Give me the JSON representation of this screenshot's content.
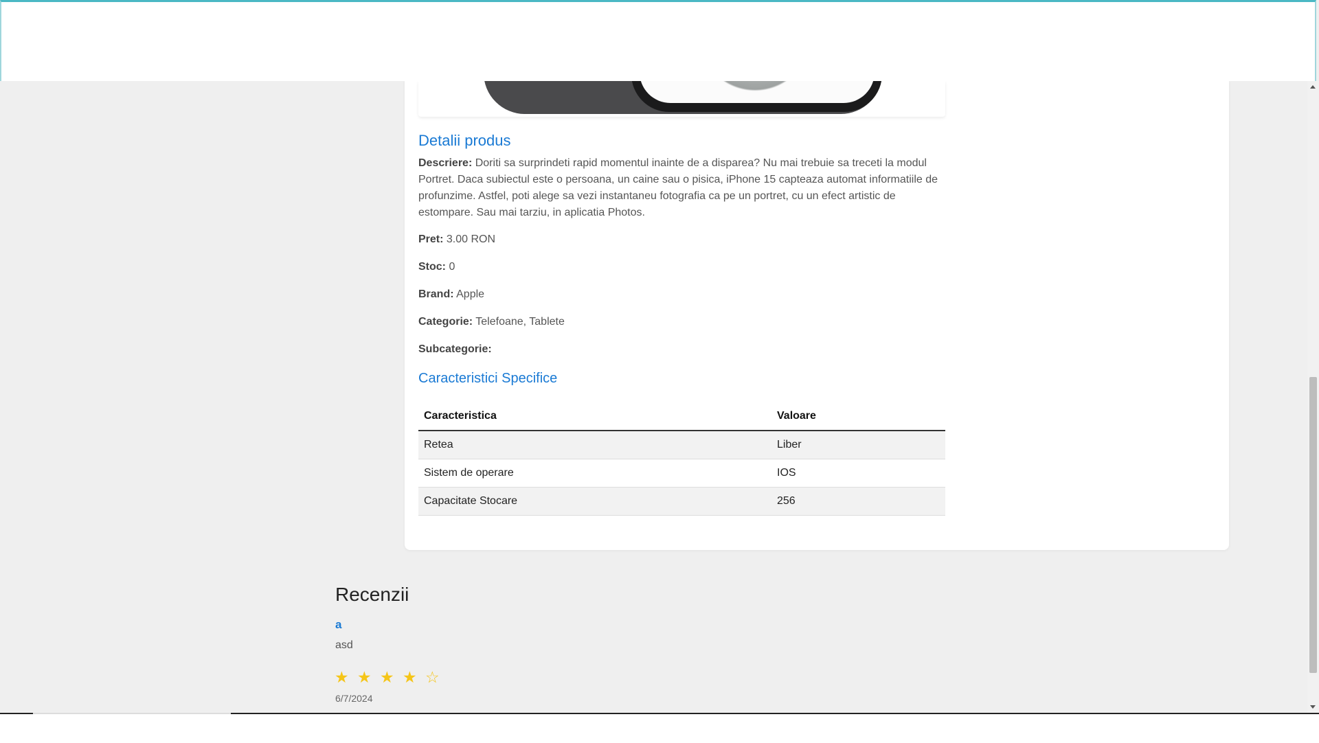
{
  "product": {
    "details_title": "Detalii produs",
    "description_label": "Descriere:",
    "description": " Doriti sa surprindeti rapid momentul inainte de a disparea? Nu mai trebuie sa treceti la modul Portret. Daca subiectul este o persoana, un caine sau o pisica, iPhone 15 capteaza automat informatiile de profunzime. Astfel, poti alege sa vezi instantaneu fotografia ca pe un portret, cu un efect artistic de estompare. Sau mai tarziu, in aplicatia Photos.",
    "price_label": "Pret:",
    "price": " 3.00 RON",
    "stock_label": "Stoc:",
    "stock": " 0",
    "brand_label": "Brand:",
    "brand": " Apple",
    "category_label": "Categorie:",
    "category": " Telefoane, Tablete",
    "subcategory_label": "Subcategorie:",
    "subcategory": ""
  },
  "specs": {
    "title": "Caracteristici Specifice",
    "header_characteristic": "Caracteristica",
    "header_value": "Valoare",
    "rows": [
      {
        "name": "Retea",
        "value": "Liber"
      },
      {
        "name": "Sistem de operare",
        "value": "IOS"
      },
      {
        "name": "Capacitate Stocare",
        "value": "256"
      }
    ]
  },
  "reviews": {
    "title": "Recenzii",
    "items": [
      {
        "author": "a",
        "text": "asd",
        "stars": "★ ★ ★ ★ ☆",
        "rating": 4,
        "max_rating": 5,
        "date": "6/7/2024"
      }
    ]
  },
  "colors": {
    "accent_blue": "#1a7ad4",
    "star_gold": "#f5c518",
    "header_border": "#4bb8c4"
  },
  "icons": {
    "scroll_up": "chevron-up-icon",
    "scroll_down": "chevron-down-icon",
    "star": "star-icon"
  }
}
